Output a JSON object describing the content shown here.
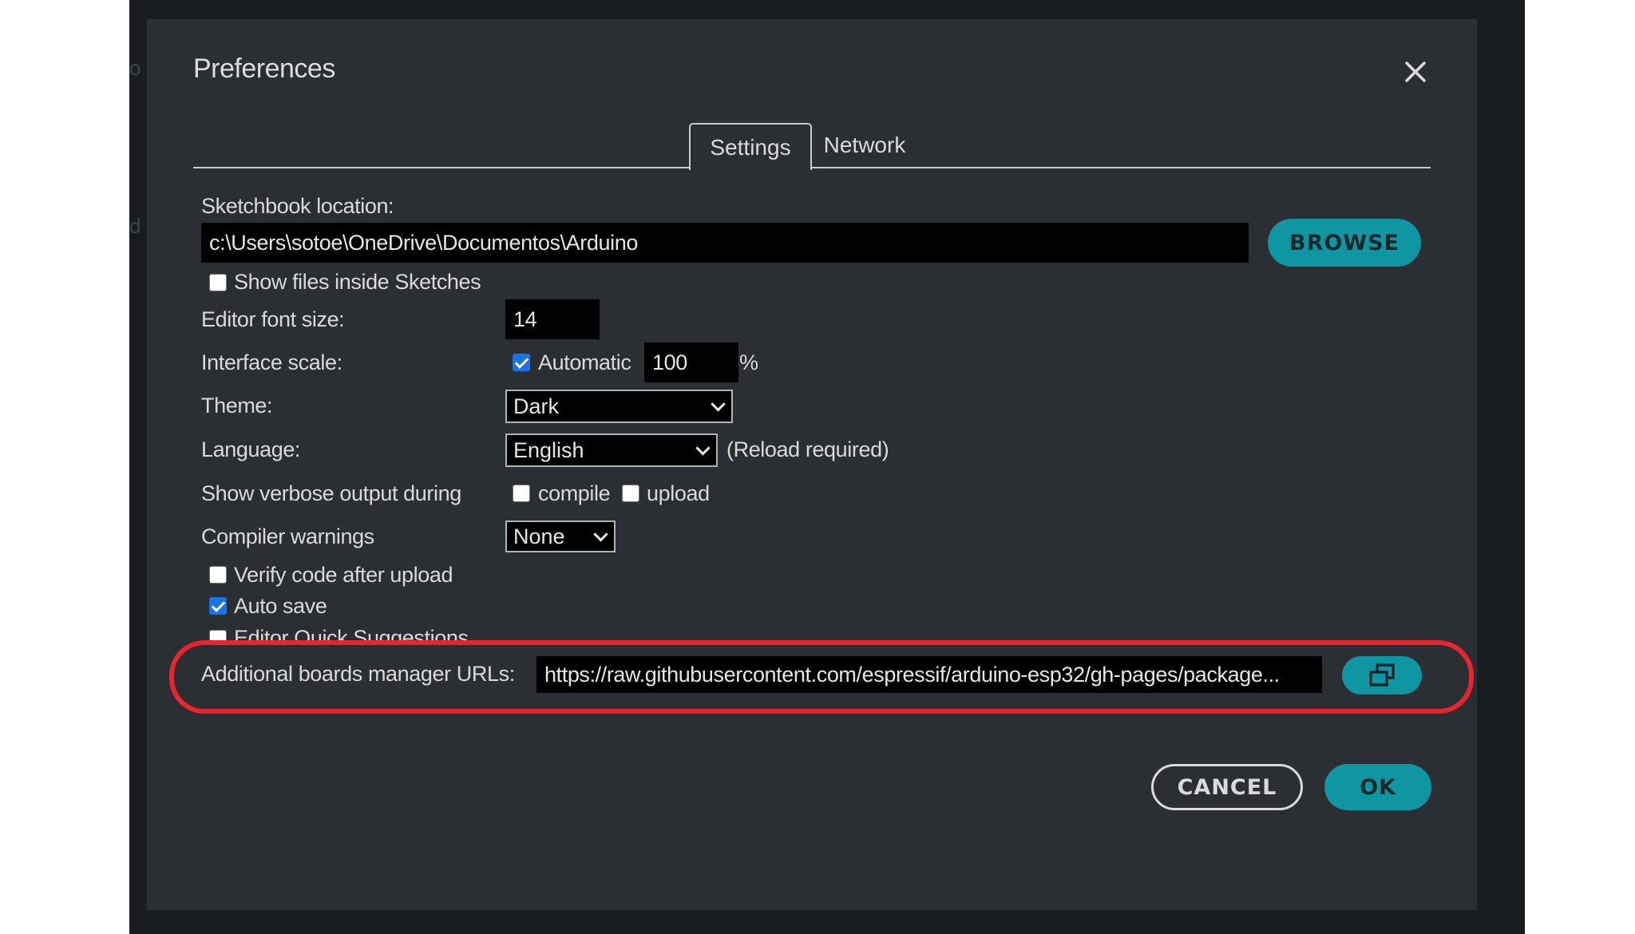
{
  "background": {
    "left_text_1": "o",
    "left_text_2": "d"
  },
  "dialog": {
    "title": "Preferences",
    "close_icon": "close-icon",
    "tabs": [
      {
        "label": "Settings",
        "active": true
      },
      {
        "label": "Network",
        "active": false
      }
    ]
  },
  "settings": {
    "sketchbook_label": "Sketchbook location:",
    "sketchbook_path": "c:\\Users\\sotoe\\OneDrive\\Documentos\\Arduino",
    "browse_label": "BROWSE",
    "show_files_label": "Show files inside Sketches",
    "show_files_checked": false,
    "font_size_label": "Editor font size:",
    "font_size_value": "14",
    "scale_label": "Interface scale:",
    "scale_automatic_label": "Automatic",
    "scale_automatic_checked": true,
    "scale_value": "100",
    "scale_unit": "%",
    "theme_label": "Theme:",
    "theme_value": "Dark",
    "language_label": "Language:",
    "language_value": "English",
    "language_note": "(Reload required)",
    "verbose_label": "Show verbose output during",
    "verbose_compile_label": "compile",
    "verbose_compile_checked": false,
    "verbose_upload_label": "upload",
    "verbose_upload_checked": false,
    "warnings_label": "Compiler warnings",
    "warnings_value": "None",
    "verify_label": "Verify code after upload",
    "verify_checked": false,
    "autosave_label": "Auto save",
    "autosave_checked": true,
    "quick_suggestions_label": "Editor Quick Suggestions",
    "urls_label": "Additional boards manager URLs:",
    "urls_value": "https://raw.githubusercontent.com/espressif/arduino-esp32/gh-pages/package..."
  },
  "footer": {
    "cancel_label": "CANCEL",
    "ok_label": "OK"
  },
  "colors": {
    "accent": "#0f96a3",
    "highlight": "#e8252f",
    "dialog_bg": "#2b2f33"
  }
}
